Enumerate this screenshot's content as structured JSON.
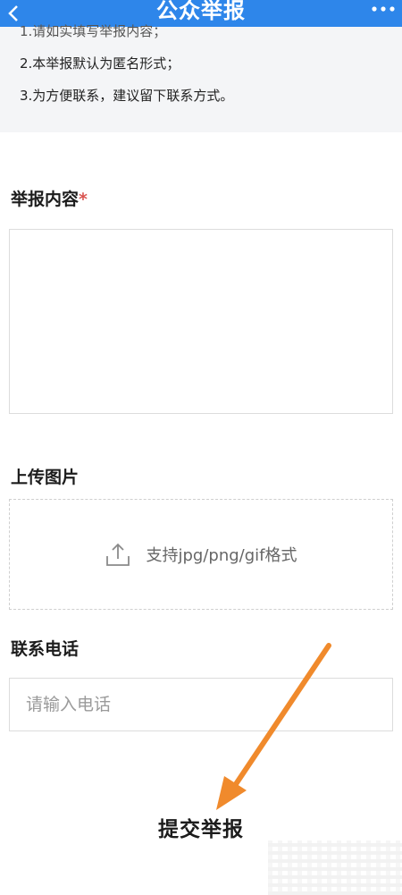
{
  "header": {
    "title": "公众举报",
    "back_icon": "chevron-left-icon",
    "more_icon": "more-dots-icon",
    "color": "#2e86ea"
  },
  "notice": {
    "line1_partial": "1.请如实填写举报内容；",
    "line2": "2.本举报默认为匿名形式；",
    "line3": "3.为方便联系，建议留下联系方式。"
  },
  "content_section": {
    "label": "举报内容",
    "required_mark": "*"
  },
  "upload_section": {
    "label": "上传图片",
    "hint": "支持jpg/png/gif格式",
    "icon": "upload-icon"
  },
  "phone_section": {
    "label": "联系电话",
    "placeholder": "请输入电话"
  },
  "submit": {
    "label": "提交举报"
  },
  "annotation": {
    "arrow_color": "#f08a2c"
  }
}
